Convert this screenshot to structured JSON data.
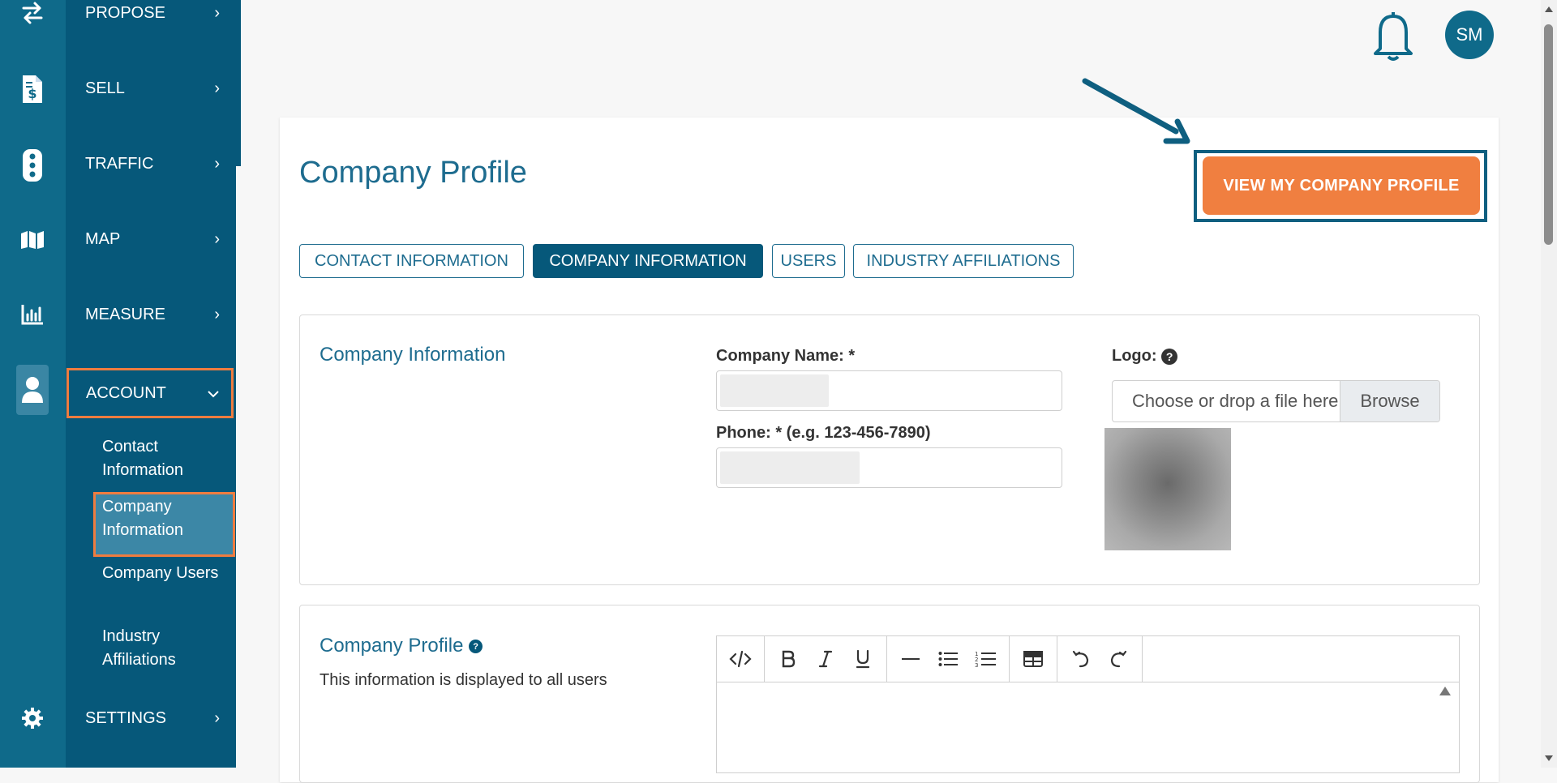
{
  "sidebar": {
    "items": [
      {
        "label": "PROPOSE",
        "icon": "swap-arrows-icon"
      },
      {
        "label": "SELL",
        "icon": "invoice-dollar-icon"
      },
      {
        "label": "TRAFFIC",
        "icon": "traffic-light-icon"
      },
      {
        "label": "MAP",
        "icon": "map-icon"
      },
      {
        "label": "MEASURE",
        "icon": "bar-chart-icon"
      },
      {
        "label": "ACCOUNT",
        "icon": "user-icon",
        "expanded": true
      },
      {
        "label": "SETTINGS",
        "icon": "gear-icon"
      }
    ],
    "account_sub": [
      "Contact Information",
      "Company Information",
      "Company Users",
      "Industry Affiliations"
    ],
    "active_sub": "Company Information"
  },
  "header": {
    "avatar_initials": "SM",
    "notification_icon": "bell-icon"
  },
  "page": {
    "title": "Company Profile",
    "cta_label": "VIEW MY COMPANY PROFILE",
    "tabs": [
      "CONTACT INFORMATION",
      "COMPANY INFORMATION",
      "USERS",
      "INDUSTRY AFFILIATIONS"
    ],
    "active_tab": "COMPANY INFORMATION"
  },
  "company_info": {
    "section_title": "Company Information",
    "company_name_label": "Company Name: *",
    "phone_label": "Phone: * (e.g. 123-456-7890)",
    "logo_label": "Logo:",
    "file_placeholder": "Choose or drop a file here",
    "browse_label": "Browse"
  },
  "company_profile": {
    "section_title": "Company Profile",
    "description": "This information is displayed to all users"
  },
  "colors": {
    "accent": "#f07f40",
    "primary": "#06587a",
    "rail": "#0f6a8a",
    "highlight_outline": "#ef7c3f"
  }
}
